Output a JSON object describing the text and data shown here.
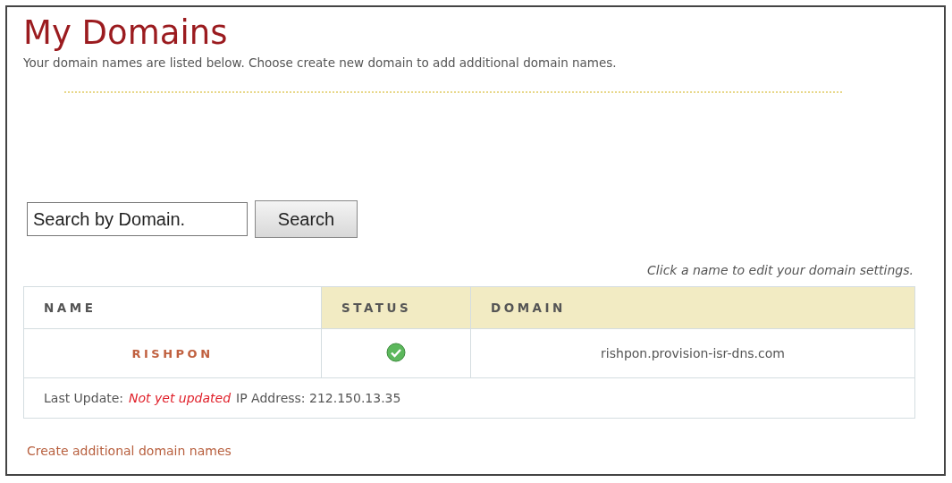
{
  "title": "My Domains",
  "subtitle": "Your domain names are listed below. Choose create new domain to add additional domain names.",
  "search": {
    "value": "Search by Domain.",
    "button": "Search"
  },
  "hint": "Click a name to edit your domain settings.",
  "table": {
    "columns": [
      {
        "label": "NAME",
        "highlighted": false
      },
      {
        "label": "STATUS",
        "highlighted": true
      },
      {
        "label": "DOMAIN",
        "highlighted": true
      }
    ],
    "rows": [
      {
        "name": "RISHPON",
        "verified": true,
        "domain": "rishpon.provision-isr-dns.com",
        "update_label": "Last Update:",
        "update_value": "Not yet updated",
        "ip": "IP Address: 212.150.13.35"
      }
    ]
  },
  "create_link": "Create additional domain names"
}
